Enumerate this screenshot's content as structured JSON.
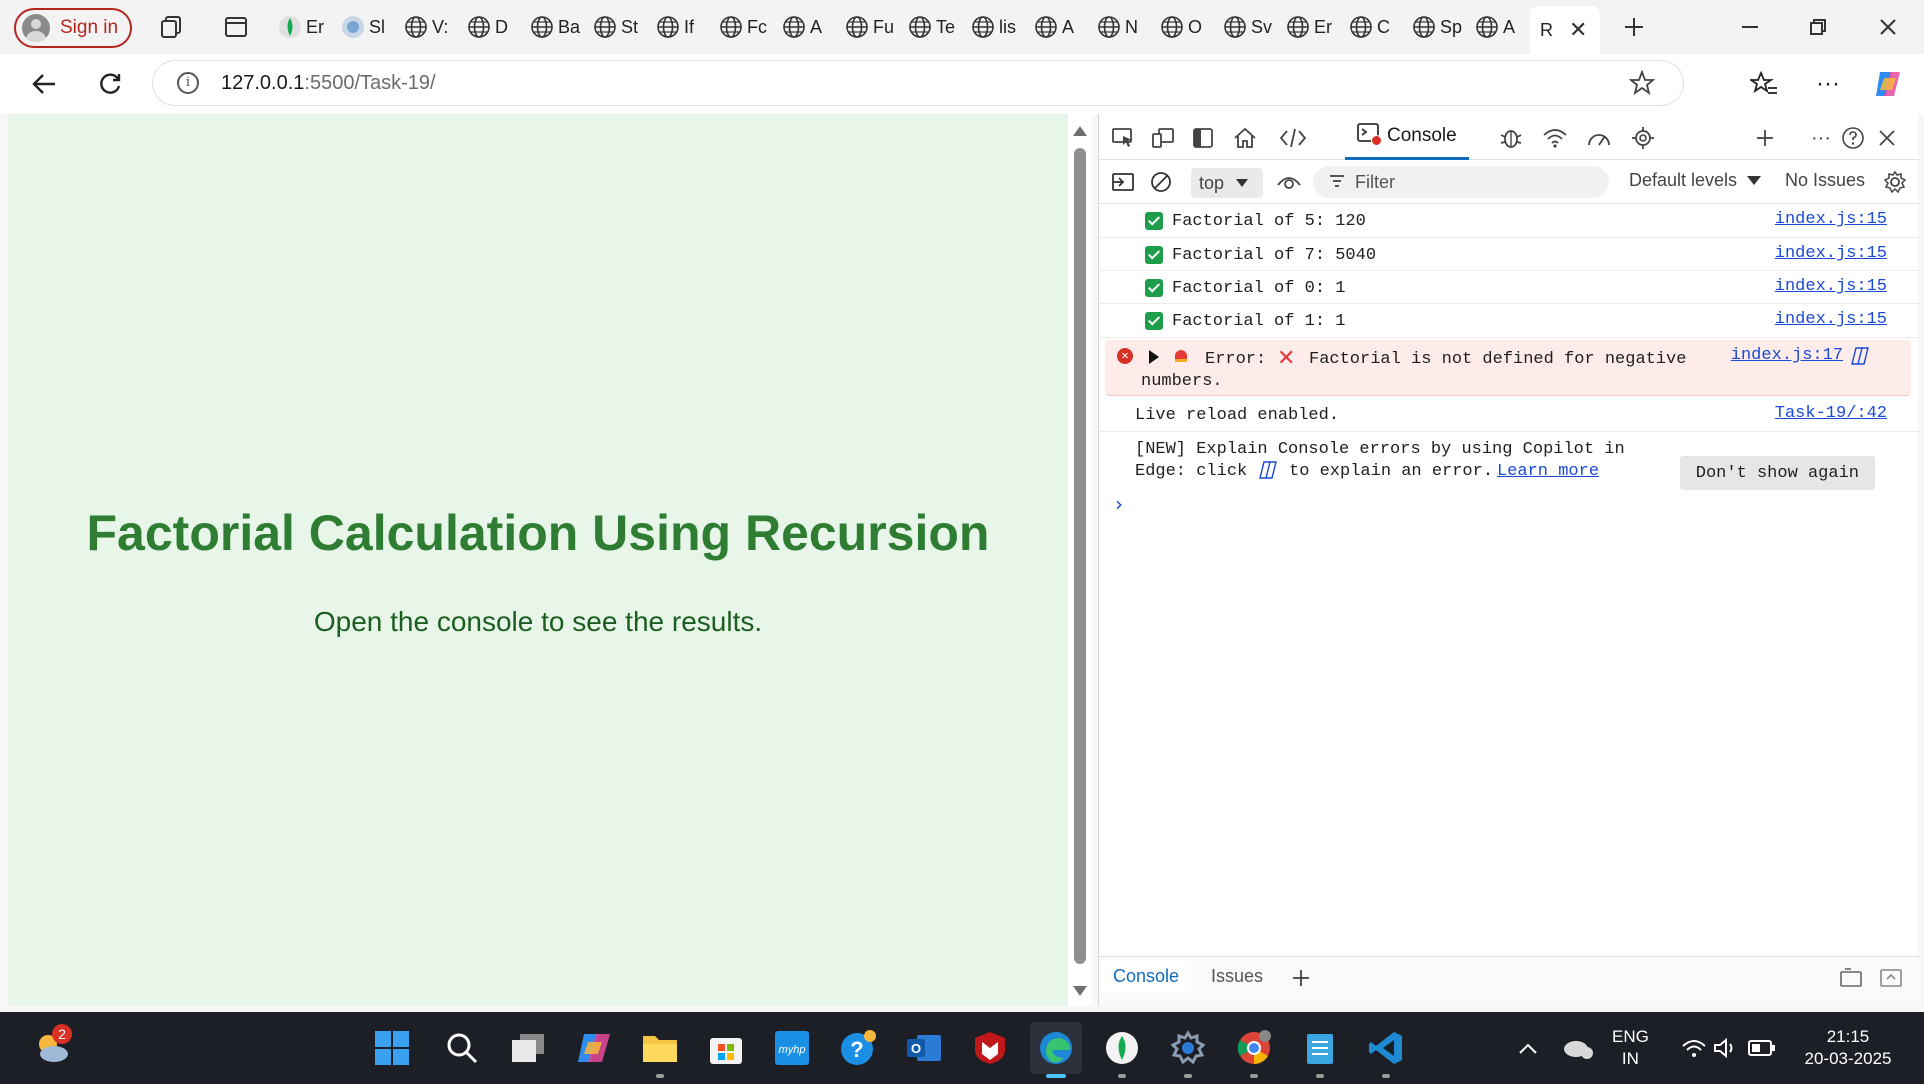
{
  "browser": {
    "sign_in": "Sign in",
    "tabs": [
      {
        "label": "Er",
        "icon": "mongodb-icon"
      },
      {
        "label": "Sl",
        "icon": "site-icon"
      },
      {
        "label": "V:",
        "icon": "globe-icon"
      },
      {
        "label": "D",
        "icon": "globe-icon"
      },
      {
        "label": "Ba",
        "icon": "globe-icon"
      },
      {
        "label": "St",
        "icon": "globe-icon"
      },
      {
        "label": "If",
        "icon": "globe-icon"
      },
      {
        "label": "Fc",
        "icon": "globe-icon"
      },
      {
        "label": "A",
        "icon": "globe-icon"
      },
      {
        "label": "Fu",
        "icon": "globe-icon"
      },
      {
        "label": "Te",
        "icon": "globe-icon"
      },
      {
        "label": "lis",
        "icon": "globe-icon"
      },
      {
        "label": "A",
        "icon": "globe-icon"
      },
      {
        "label": "N",
        "icon": "globe-icon"
      },
      {
        "label": "O",
        "icon": "globe-icon"
      },
      {
        "label": "Sv",
        "icon": "globe-icon"
      },
      {
        "label": "Er",
        "icon": "globe-icon"
      },
      {
        "label": "C",
        "icon": "globe-icon"
      },
      {
        "label": "Sp",
        "icon": "globe-icon"
      },
      {
        "label": "A",
        "icon": "globe-icon"
      }
    ],
    "active_tab": "R",
    "url_host": "127.0.0.1",
    "url_rest": ":5500/Task-19/"
  },
  "page": {
    "title": "Factorial Calculation Using Recursion",
    "subtitle": "Open the console to see the results."
  },
  "devtools": {
    "panel_tab": "Console",
    "context": "top",
    "filter_placeholder": "Filter",
    "levels": "Default levels",
    "issues": "No Issues",
    "logs": [
      {
        "text": "Factorial of 5: 120",
        "src": "index.js:15"
      },
      {
        "text": "Factorial of 7: 5040",
        "src": "index.js:15"
      },
      {
        "text": "Factorial of 0: 1",
        "src": "index.js:15"
      },
      {
        "text": "Factorial of 1: 1",
        "src": "index.js:15"
      }
    ],
    "error": {
      "prefix": "Error:",
      "message": "Factorial is not defined for negative",
      "message2": "numbers.",
      "src": "index.js:17"
    },
    "live_reload": {
      "text": "Live reload enabled.",
      "src": "Task-19/:42"
    },
    "copilot": {
      "line1": "[NEW] Explain Console errors by using Copilot in",
      "line2a": "Edge: click",
      "line2b": "to explain an error.",
      "learn_more": "Learn more",
      "dismiss": "Don't show again"
    },
    "bottom_tabs": [
      "Console",
      "Issues"
    ]
  },
  "taskbar": {
    "weather_badge": "2",
    "lang1": "ENG",
    "lang2": "IN",
    "time": "21:15",
    "date": "20-03-2025"
  }
}
